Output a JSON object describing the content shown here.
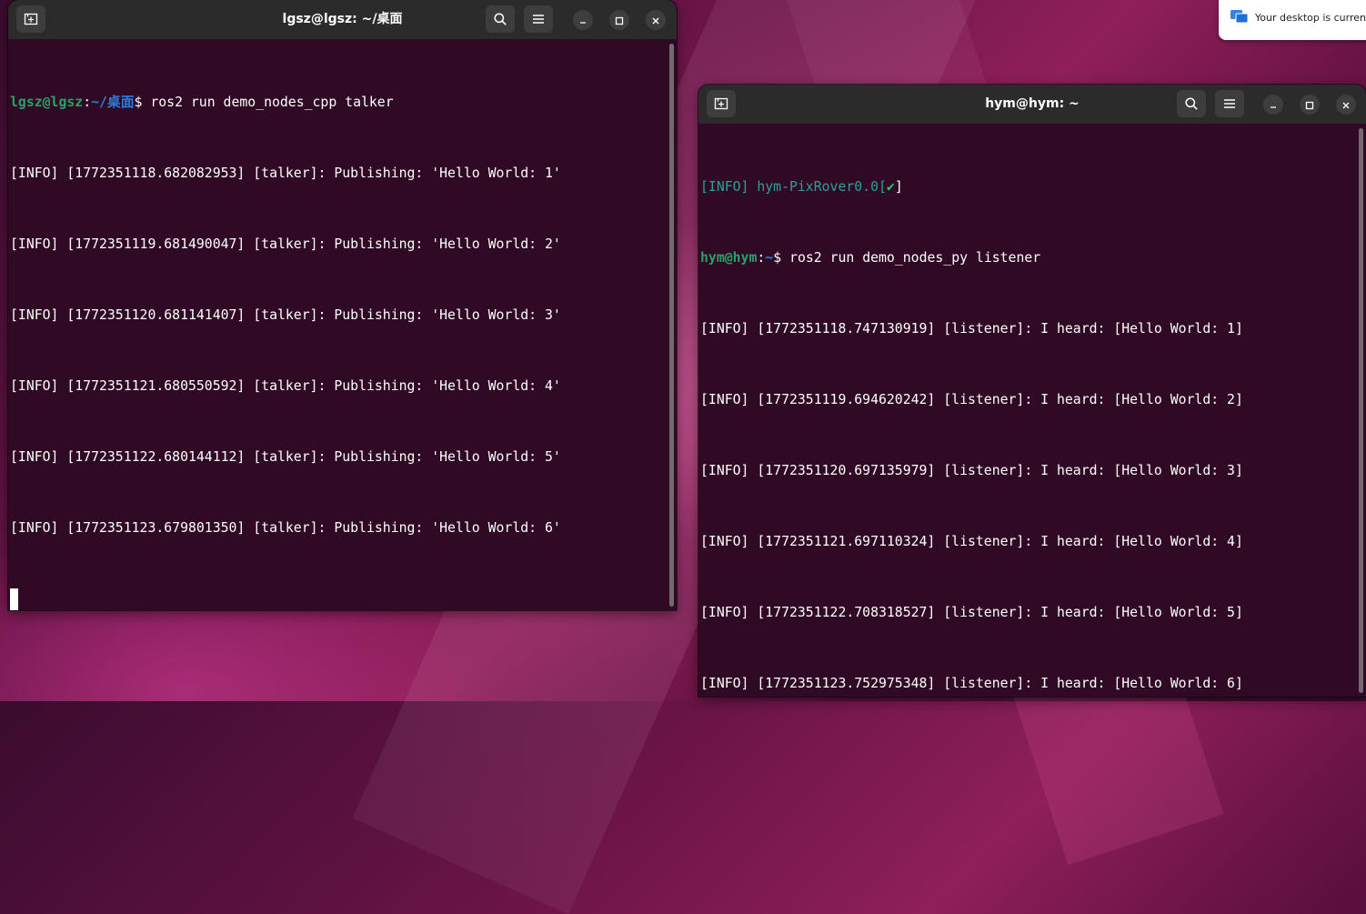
{
  "colors": {
    "terminal_bg": "#300a24",
    "titlebar_bg": "#2b2b2b",
    "prompt_user": "#26a269",
    "prompt_path": "#2a7bde",
    "info_teal": "#2aa198",
    "check_green": "#2ec27e"
  },
  "notification": {
    "icon": "remote-desktop-icon",
    "text": "Your desktop is currently"
  },
  "left_terminal": {
    "title": "lgsz@lgsz: ~/桌面",
    "icons": [
      "new-tab-icon",
      "search-icon",
      "hamburger-menu-icon",
      "minimize-icon",
      "maximize-icon",
      "close-icon"
    ],
    "prompt_user": "lgsz@lgsz",
    "prompt_colon": ":",
    "prompt_path": "~/桌面",
    "prompt_symbol": "$ ",
    "command": "ros2 run demo_nodes_cpp talker",
    "output": [
      "[INFO] [1772351118.682082953] [talker]: Publishing: 'Hello World: 1'",
      "[INFO] [1772351119.681490047] [talker]: Publishing: 'Hello World: 2'",
      "[INFO] [1772351120.681141407] [talker]: Publishing: 'Hello World: 3'",
      "[INFO] [1772351121.680550592] [talker]: Publishing: 'Hello World: 4'",
      "[INFO] [1772351122.680144112] [talker]: Publishing: 'Hello World: 5'",
      "[INFO] [1772351123.679801350] [talker]: Publishing: 'Hello World: 6'"
    ]
  },
  "right_terminal": {
    "title": "hym@hym: ~",
    "icons": [
      "new-tab-icon",
      "search-icon",
      "hamburger-menu-icon",
      "minimize-icon",
      "maximize-icon",
      "close-icon"
    ],
    "info_prefix": "[INFO] hym-PixRover0.0[",
    "info_check": "✔",
    "info_suffix": "]",
    "prompt_user": "hym@hym",
    "prompt_colon": ":",
    "prompt_path": "~",
    "prompt_symbol": "$ ",
    "command": "ros2 run demo_nodes_py listener",
    "output": [
      "[INFO] [1772351118.747130919] [listener]: I heard: [Hello World: 1]",
      "[INFO] [1772351119.694620242] [listener]: I heard: [Hello World: 2]",
      "[INFO] [1772351120.697135979] [listener]: I heard: [Hello World: 3]",
      "[INFO] [1772351121.697110324] [listener]: I heard: [Hello World: 4]",
      "[INFO] [1772351122.708318527] [listener]: I heard: [Hello World: 5]",
      "[INFO] [1772351123.752975348] [listener]: I heard: [Hello World: 6]"
    ]
  }
}
